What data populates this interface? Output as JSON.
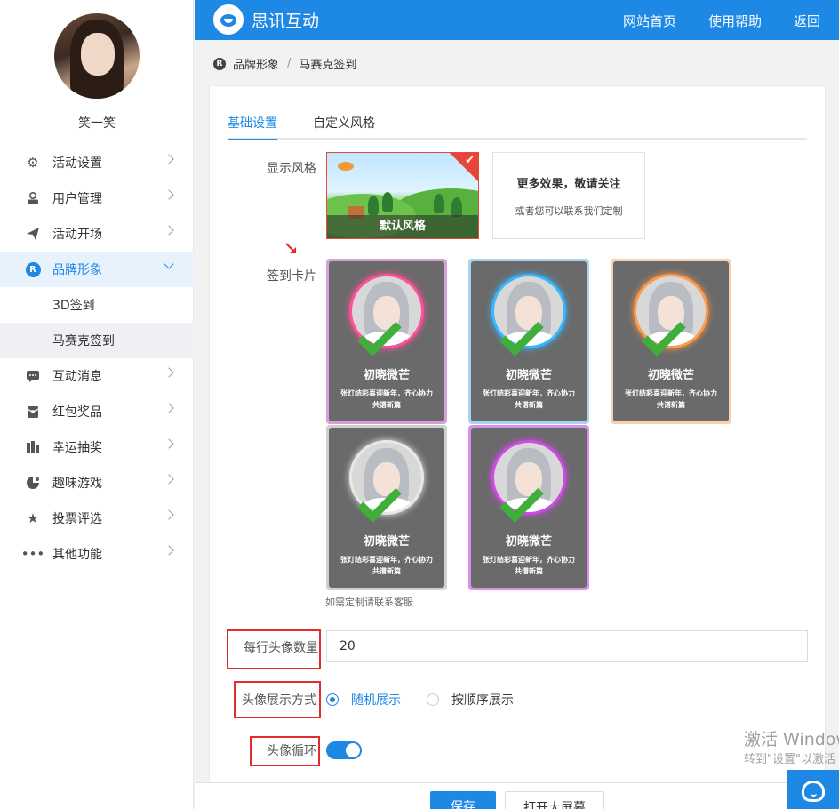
{
  "header": {
    "brand": "思讯互动",
    "links": [
      "网站首页",
      "使用帮助",
      "返回"
    ]
  },
  "user": {
    "name": "笑一笑"
  },
  "sidebar": {
    "items": [
      {
        "label": "活动设置",
        "icon": "gear-icon"
      },
      {
        "label": "用户管理",
        "icon": "user-icon"
      },
      {
        "label": "活动开场",
        "icon": "paper-plane-icon"
      },
      {
        "label": "品牌形象",
        "icon": "brand-r-icon",
        "badge": "R",
        "expanded": true,
        "children": [
          {
            "label": "3D签到"
          },
          {
            "label": "马赛克签到",
            "selected": true
          }
        ]
      },
      {
        "label": "互动消息",
        "icon": "chat-icon"
      },
      {
        "label": "红包奖品",
        "icon": "gift-icon"
      },
      {
        "label": "幸运抽奖",
        "icon": "lottery-icon"
      },
      {
        "label": "趣味游戏",
        "icon": "game-icon"
      },
      {
        "label": "投票评选",
        "icon": "star-icon"
      },
      {
        "label": "其他功能",
        "icon": "more-icon"
      }
    ]
  },
  "breadcrumb": {
    "badge": "R",
    "parent": "品牌形象",
    "separator": "/",
    "current": "马赛克签到"
  },
  "tabs": [
    {
      "label": "基础设置",
      "active": true
    },
    {
      "label": "自定义风格",
      "active": false
    }
  ],
  "display_style": {
    "label": "显示风格",
    "default_card": {
      "caption": "默认风格",
      "selected": true
    },
    "more_card": {
      "title": "更多效果，敬请关注",
      "subtitle": "或者您可以联系我们定制"
    }
  },
  "sign_cards": {
    "label": "签到卡片",
    "cards": [
      {
        "name": "初晓微芒",
        "message": "张灯结彩喜迎新年，齐心协力共谱新篇",
        "frame_color": "#d8a0d8",
        "ring_color": "#ff4f9a",
        "selected": true
      },
      {
        "name": "初晓微芒",
        "message": "张灯结彩喜迎新年，齐心协力共谱新篇",
        "frame_color": "#a8d4f0",
        "ring_color": "#36b7ff",
        "selected": true
      },
      {
        "name": "初晓微芒",
        "message": "张灯结彩喜迎新年，齐心协力共谱新篇",
        "frame_color": "#f7d0b0",
        "ring_color": "#ff9a4a",
        "selected": true
      },
      {
        "name": "初晓微芒",
        "message": "张灯结彩喜迎新年，齐心协力共谱新篇",
        "frame_color": "#d0d0d0",
        "ring_color": "#e8e8e8",
        "selected": true
      },
      {
        "name": "初晓微芒",
        "message": "张灯结彩喜迎新年，齐心协力共谱新篇",
        "frame_color": "#d890e8",
        "ring_color": "#d04ae8",
        "selected": true
      }
    ],
    "hint": "如需定制请联系客服"
  },
  "avatars_per_row": {
    "label": "每行头像数量",
    "value": "20"
  },
  "avatar_display": {
    "label": "头像展示方式",
    "options": [
      "随机展示",
      "按顺序展示"
    ],
    "selected": "随机展示"
  },
  "avatar_loop": {
    "label": "头像循环",
    "enabled": true
  },
  "buttons": {
    "save": "保存",
    "open_screen": "打开大屏幕"
  },
  "watermark": {
    "line1": "激活 Windows",
    "line2": "转到\"设置\"以激活 Windows。"
  },
  "colors": {
    "primary": "#1e88e5",
    "highlight_box": "#e52b2b"
  }
}
